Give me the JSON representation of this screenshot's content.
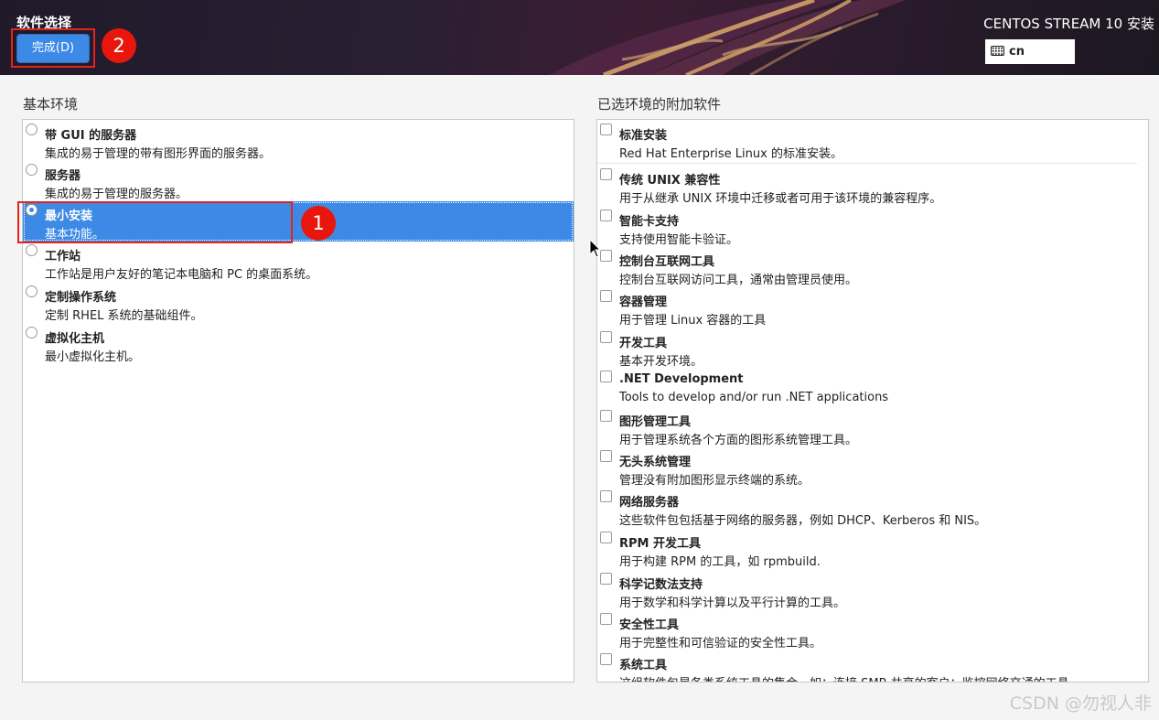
{
  "header": {
    "title": "软件选择",
    "done_label": "完成(D)",
    "product_title": "CENTOS STREAM 10 安装",
    "keyboard_layout": "cn"
  },
  "annotations": {
    "one": "1",
    "two": "2",
    "color": "#e8160c"
  },
  "base_env": {
    "label": "基本环境",
    "items": [
      {
        "name": "带 GUI 的服务器",
        "desc": "集成的易于管理的带有图形界面的服务器。",
        "selected": false
      },
      {
        "name": "服务器",
        "desc": "集成的易于管理的服务器。",
        "selected": false
      },
      {
        "name": "最小安装",
        "desc": "基本功能。",
        "selected": true
      },
      {
        "name": "工作站",
        "desc": "工作站是用户友好的笔记本电脑和 PC 的桌面系统。",
        "selected": false
      },
      {
        "name": "定制操作系统",
        "desc": "定制 RHEL 系统的基础组件。",
        "selected": false
      },
      {
        "name": "虚拟化主机",
        "desc": "最小虚拟化主机。",
        "selected": false
      }
    ]
  },
  "addons": {
    "label": "已选环境的附加软件",
    "items": [
      {
        "name": "标准安装",
        "desc": "Red Hat Enterprise Linux 的标准安装。",
        "checked": false
      },
      {
        "name": "传统 UNIX 兼容性",
        "desc": "用于从继承 UNIX 环境中迁移或者可用于该环境的兼容程序。",
        "checked": false
      },
      {
        "name": "智能卡支持",
        "desc": "支持使用智能卡验证。",
        "checked": false
      },
      {
        "name": "控制台互联网工具",
        "desc": "控制台互联网访问工具，通常由管理员使用。",
        "checked": false
      },
      {
        "name": "容器管理",
        "desc": "用于管理 Linux 容器的工具",
        "checked": false
      },
      {
        "name": "开发工具",
        "desc": "基本开发环境。",
        "checked": false
      },
      {
        "name": ".NET Development",
        "desc": "Tools to develop and/or run .NET applications",
        "checked": false
      },
      {
        "name": "图形管理工具",
        "desc": "用于管理系统各个方面的图形系统管理工具。",
        "checked": false
      },
      {
        "name": "无头系统管理",
        "desc": "管理没有附加图形显示终端的系统。",
        "checked": false
      },
      {
        "name": "网络服务器",
        "desc": "这些软件包包括基于网络的服务器，例如 DHCP、Kerberos 和 NIS。",
        "checked": false
      },
      {
        "name": "RPM 开发工具",
        "desc": "用于构建 RPM 的工具，如 rpmbuild.",
        "checked": false
      },
      {
        "name": "科学记数法支持",
        "desc": "用于数学和科学计算以及平行计算的工具。",
        "checked": false
      },
      {
        "name": "安全性工具",
        "desc": "用于完整性和可信验证的安全性工具。",
        "checked": false
      },
      {
        "name": "系统工具",
        "desc": "这组软件包是各类系统工具的集合，如：连接 SMB 共享的客户；监控网络交通的工具。",
        "checked": false
      }
    ]
  },
  "watermark": "CSDN @勿视人非",
  "colors": {
    "accent": "#3d8ae6",
    "annotation": "#e2241c"
  }
}
